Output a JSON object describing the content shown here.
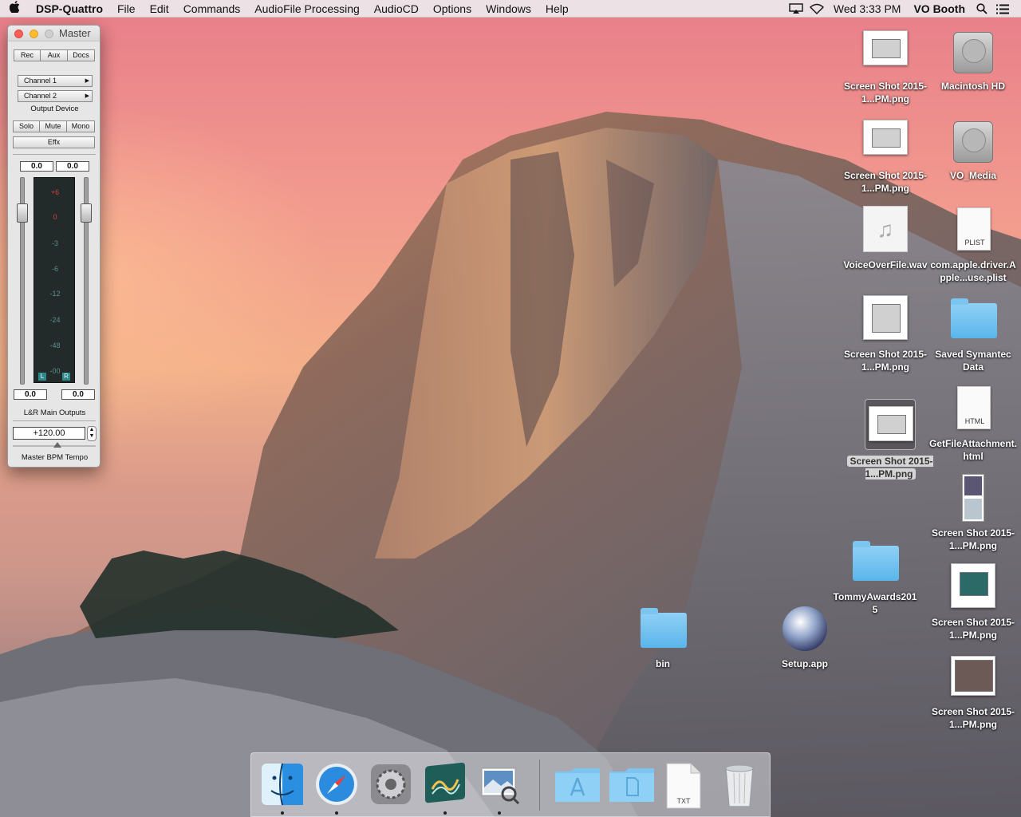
{
  "menubar": {
    "app_name": "DSP-Quattro",
    "menus": [
      "File",
      "Edit",
      "Commands",
      "AudioFile Processing",
      "AudioCD",
      "Options",
      "Windows",
      "Help"
    ],
    "clock": "Wed 3:33 PM",
    "user": "VO Booth"
  },
  "master_window": {
    "title": "Master",
    "tabs": [
      "Rec",
      "Aux",
      "Docs"
    ],
    "channel1": "Channel  1",
    "channel2": "Channel  2",
    "output_device_label": "Output Device",
    "solo": "Solo",
    "mute": "Mute",
    "mono": "Mono",
    "effx": "Effx",
    "top_left_value": "0.0",
    "top_right_value": "0.0",
    "bottom_left_value": "0.0",
    "bottom_right_value": "0.0",
    "meter_ticks": [
      "+6",
      "0",
      "-3",
      "-6",
      "-12",
      "-24",
      "-48",
      "-00"
    ],
    "meter_left": "L",
    "meter_right": "R",
    "outputs_label": "L&R Main Outputs",
    "bpm_value": "+120.00",
    "bpm_label": "Master BPM Tempo"
  },
  "desktop": {
    "icons": [
      {
        "name": "Screen Shot 2015-1...PM.png"
      },
      {
        "name": "Macintosh HD"
      },
      {
        "name": "Screen Shot 2015-1...PM.png"
      },
      {
        "name": "VO_Media"
      },
      {
        "name": "VoiceOverFile.wav"
      },
      {
        "name": "com.apple.driver.Apple...use.plist",
        "tag": "PLIST"
      },
      {
        "name": "Screen Shot 2015-1...PM.png"
      },
      {
        "name": "Saved Symantec Data"
      },
      {
        "name": "Screen Shot 2015-1...PM.png"
      },
      {
        "name": "GetFileAttachment.html",
        "tag": "HTML"
      },
      {
        "name": "Screen Shot 2015-1...PM.png"
      },
      {
        "name": "TommyAwards2015"
      },
      {
        "name": "Screen Shot 2015-1...PM.png"
      },
      {
        "name": "bin"
      },
      {
        "name": "Setup.app"
      },
      {
        "name": "Screen Shot 2015-1...PM.png"
      }
    ]
  },
  "dock": {
    "txt_tag": "TXT"
  }
}
